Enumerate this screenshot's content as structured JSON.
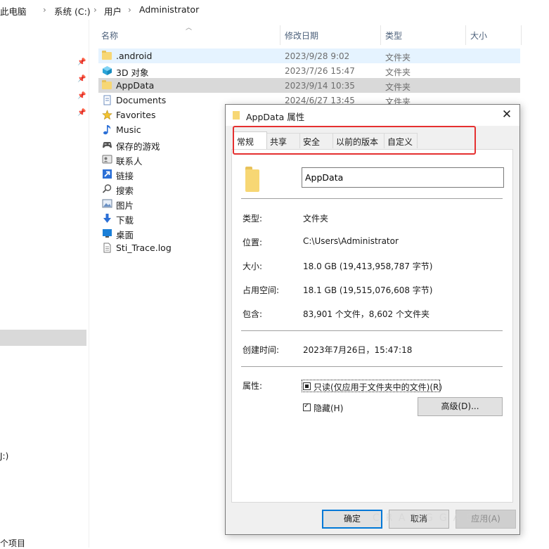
{
  "breadcrumb": [
    "此电脑",
    "系统 (C:)",
    "用户",
    "Administrator"
  ],
  "columns": {
    "name": "名称",
    "date": "修改日期",
    "type": "类型",
    "size": "大小"
  },
  "files": [
    {
      "name": ".android",
      "date": "2023/9/28 9:02",
      "type": "文件夹",
      "icon": "folder-icon"
    },
    {
      "name": "3D 对象",
      "date": "2023/7/26 15:47",
      "type": "文件夹",
      "icon": "3d-objects-icon"
    },
    {
      "name": "AppData",
      "date": "2023/9/14 10:35",
      "type": "文件夹",
      "icon": "folder-icon"
    },
    {
      "name": "Documents",
      "date": "2024/6/27 13:45",
      "type": "文件夹",
      "icon": "documents-icon"
    },
    {
      "name": "Favorites",
      "icon": "star-icon"
    },
    {
      "name": "Music",
      "icon": "music-icon"
    },
    {
      "name": "保存的游戏",
      "icon": "saved-games-icon"
    },
    {
      "name": "联系人",
      "icon": "contacts-icon"
    },
    {
      "name": "链接",
      "icon": "link-icon"
    },
    {
      "name": "搜索",
      "icon": "search-icon"
    },
    {
      "name": "图片",
      "icon": "pictures-icon"
    },
    {
      "name": "下载",
      "icon": "download-icon"
    },
    {
      "name": "桌面",
      "icon": "desktop-icon"
    },
    {
      "name": "Sti_Trace.log",
      "icon": "file-icon"
    }
  ],
  "nav": {
    "drive_fragment": "J:)"
  },
  "status": {
    "text": "个项目"
  },
  "dialog": {
    "title": "AppData 属性",
    "close": "✕",
    "tabs": [
      "常规",
      "共享",
      "安全",
      "以前的版本",
      "自定义"
    ],
    "active_tab": "常规",
    "folder_name": "AppData",
    "props": [
      {
        "label": "类型:",
        "value": "文件夹"
      },
      {
        "label": "位置:",
        "value": "C:\\Users\\Administrator"
      },
      {
        "label": "大小:",
        "value": "18.0 GB (19,413,958,787 字节)"
      },
      {
        "label": "占用空间:",
        "value": "18.1 GB (19,515,076,608 字节)"
      },
      {
        "label": "包含:",
        "value": "83,901 个文件，8,602 个文件夹"
      }
    ],
    "created": {
      "label": "创建时间:",
      "value": "2023年7月26日，15:47:18"
    },
    "attributes": {
      "label": "属性:",
      "readonly": "只读(仅应用于文件夹中的文件)(R)",
      "readonly_state": "indeterminate",
      "hidden": "隐藏(H)",
      "hidden_state": "checked",
      "advanced": "高级(D)..."
    },
    "buttons": {
      "ok": "确定",
      "cancel": "取消",
      "apply": "应用(A)"
    }
  },
  "watermark": "CRANGGACK",
  "colors": {
    "highlight": "#e53030",
    "hover_row": "#e5f3ff",
    "selected_row": "#d9d9d9",
    "accent": "#0078d7"
  }
}
